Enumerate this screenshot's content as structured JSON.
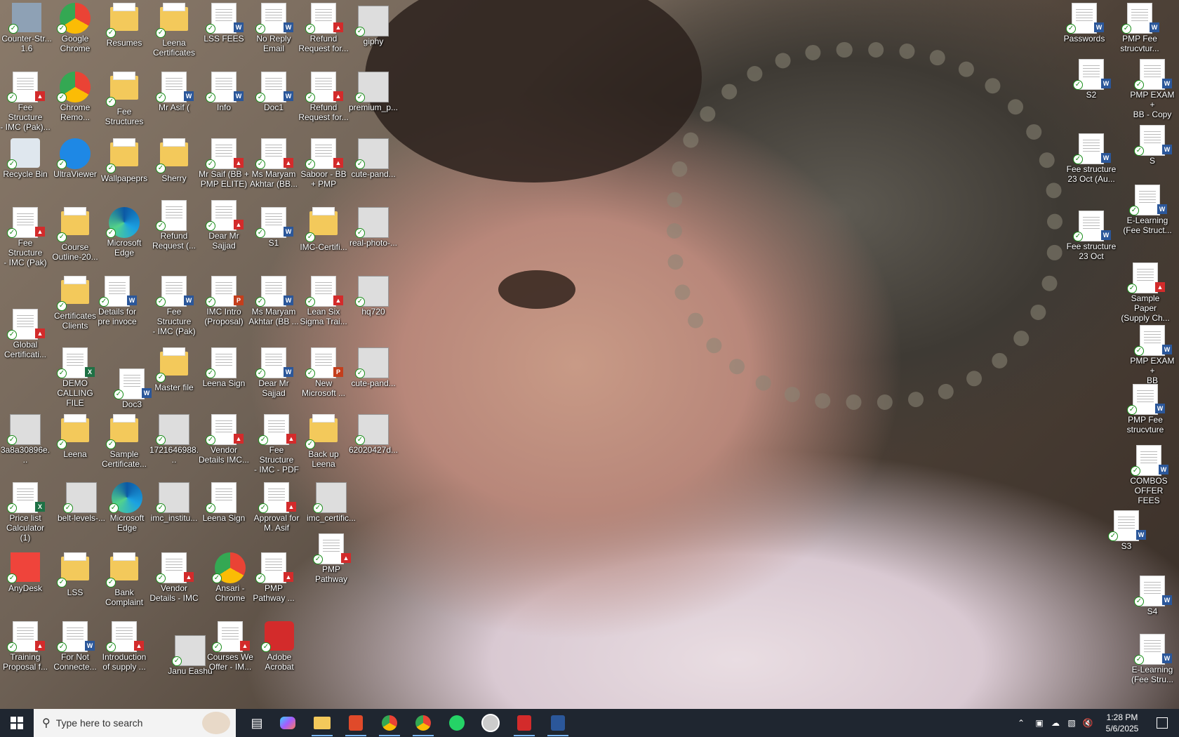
{
  "desktop": {
    "icons": [
      {
        "label": "Counter-Str...\n1.6",
        "kind": "game"
      },
      {
        "label": "Google\nChrome",
        "kind": "chrome"
      },
      {
        "label": "Resumes",
        "kind": "folder"
      },
      {
        "label": "Leena\nCertificates",
        "kind": "folder"
      },
      {
        "label": "LSS FEES",
        "kind": "word"
      },
      {
        "label": "No Reply\nEmail",
        "kind": "word"
      },
      {
        "label": "Refund\nRequest for...",
        "kind": "pdf"
      },
      {
        "label": "giphy",
        "kind": "photo"
      },
      {
        "label": "Fee Structure\n- IMC (Pak)...",
        "kind": "pdf"
      },
      {
        "label": "Chrome\nRemo...",
        "kind": "chrome"
      },
      {
        "label": "Fee\nStructures",
        "kind": "folder"
      },
      {
        "label": "Mr Asif (",
        "kind": "word"
      },
      {
        "label": "Info",
        "kind": "word"
      },
      {
        "label": "Doc1",
        "kind": "word"
      },
      {
        "label": "Refund\nRequest for...",
        "kind": "pdf"
      },
      {
        "label": "premium_p...",
        "kind": "photo"
      },
      {
        "label": "Recycle Bin",
        "kind": "bin"
      },
      {
        "label": "UltraViewer",
        "kind": "ultraviewer"
      },
      {
        "label": "Wallpapeprs",
        "kind": "folder"
      },
      {
        "label": "Sherry",
        "kind": "folder"
      },
      {
        "label": "Mr Saif (BB +\nPMP ELITE)",
        "kind": "pdf"
      },
      {
        "label": "Ms Maryam\nAkhtar (BB...",
        "kind": "pdf"
      },
      {
        "label": "Saboor - BB\n+ PMP",
        "kind": "pdf"
      },
      {
        "label": "cute-pand...",
        "kind": "photo"
      },
      {
        "label": "Fee Structure\n- IMC (Pak)",
        "kind": "pdf"
      },
      {
        "label": "Course\nOutline-20...",
        "kind": "folder"
      },
      {
        "label": "Microsoft\nEdge",
        "kind": "edge"
      },
      {
        "label": "Refund\nRequest (...",
        "kind": "doc"
      },
      {
        "label": "Dear Mr\nSajjad",
        "kind": "pdf"
      },
      {
        "label": "S1",
        "kind": "word"
      },
      {
        "label": "IMC-Certifi...",
        "kind": "folder"
      },
      {
        "label": "real-photo-...",
        "kind": "photo"
      },
      {
        "label": "Global\nCertificati...",
        "kind": "pdf"
      },
      {
        "label": "Certificates\nClients",
        "kind": "folder"
      },
      {
        "label": "Details for\npre invoce",
        "kind": "word"
      },
      {
        "label": "Fee Structure\n- IMC (Pak)",
        "kind": "word"
      },
      {
        "label": "IMC Intro\n(Proposal)",
        "kind": "ppt"
      },
      {
        "label": "Ms Maryam\nAkhtar (BB ...",
        "kind": "word"
      },
      {
        "label": "Lean Six\nSigma Trai...",
        "kind": "pdf"
      },
      {
        "label": "hq720",
        "kind": "photo"
      },
      {
        "label": "DEMO\nCALLING FILE",
        "kind": "excel"
      },
      {
        "label": "Doc3",
        "kind": "word"
      },
      {
        "label": "Master file",
        "kind": "folder"
      },
      {
        "label": "Leena Sign",
        "kind": "doc"
      },
      {
        "label": "Dear Mr\nSajjad",
        "kind": "word"
      },
      {
        "label": "New\nMicrosoft ...",
        "kind": "ppt"
      },
      {
        "label": "cute-pand...",
        "kind": "photo"
      },
      {
        "label": "3a8a30896e...",
        "kind": "photo"
      },
      {
        "label": "Leena",
        "kind": "folder"
      },
      {
        "label": "Sample\nCertificate...",
        "kind": "folder"
      },
      {
        "label": "1721646988...",
        "kind": "photo"
      },
      {
        "label": "Vendor\nDetails IMC...",
        "kind": "pdf"
      },
      {
        "label": "Fee Structure\n- IMC - PDF",
        "kind": "pdf"
      },
      {
        "label": "Back up\nLeena",
        "kind": "folder"
      },
      {
        "label": "62020427d...",
        "kind": "photo"
      },
      {
        "label": "Price list\nCalculator (1)",
        "kind": "excel"
      },
      {
        "label": "belt-levels-...",
        "kind": "photo"
      },
      {
        "label": "Microsoft\nEdge",
        "kind": "edge"
      },
      {
        "label": "imc_institu...",
        "kind": "photo"
      },
      {
        "label": "Leena Sign",
        "kind": "doc"
      },
      {
        "label": "Approval for\nM. Asif",
        "kind": "pdf"
      },
      {
        "label": "imc_certific...",
        "kind": "photo"
      },
      {
        "label": "PMP\nPathway",
        "kind": "pdf"
      },
      {
        "label": "AnyDesk",
        "kind": "anydesk"
      },
      {
        "label": "LSS",
        "kind": "folder"
      },
      {
        "label": "Bank\nComplaint",
        "kind": "folder"
      },
      {
        "label": "Vendor\nDetails - IMC",
        "kind": "pdf"
      },
      {
        "label": "Ansari -\nChrome",
        "kind": "chrome"
      },
      {
        "label": "PMP\nPathway ...",
        "kind": "pdf"
      },
      {
        "label": "Training\nProposal f...",
        "kind": "pdf"
      },
      {
        "label": "For Not\nConnecte...",
        "kind": "word"
      },
      {
        "label": "Introduction\nof supply ...",
        "kind": "pdf"
      },
      {
        "label": "Janu Eashu",
        "kind": "photo"
      },
      {
        "label": "Courses We\nOffer - IM...",
        "kind": "pdf"
      },
      {
        "label": "Adobe\nAcrobat",
        "kind": "acrobat"
      },
      {
        "label": "Passwords",
        "kind": "word"
      },
      {
        "label": "PMP Fee\nstrucvtur...",
        "kind": "word"
      },
      {
        "label": "S2",
        "kind": "word"
      },
      {
        "label": "PMP EXAM +\nBB - Copy",
        "kind": "word"
      },
      {
        "label": "S",
        "kind": "word"
      },
      {
        "label": "Fee structure\n23 Oct (Au...",
        "kind": "word"
      },
      {
        "label": "E-Learning\n(Fee Struct...",
        "kind": "word"
      },
      {
        "label": "Fee structure\n23 Oct",
        "kind": "word"
      },
      {
        "label": "Sample Paper\n(Supply Ch...",
        "kind": "pdf"
      },
      {
        "label": "PMP EXAM +\nBB",
        "kind": "word"
      },
      {
        "label": "PMP Fee\nstrucvture",
        "kind": "word"
      },
      {
        "label": "COMBOS\nOFFER FEES",
        "kind": "word"
      },
      {
        "label": "S3",
        "kind": "word"
      },
      {
        "label": "S4",
        "kind": "word"
      },
      {
        "label": "E-Learning\n(Fee Stru...",
        "kind": "word"
      }
    ]
  },
  "taskbar": {
    "search_placeholder": "Type here to search",
    "apps": [
      "task-view",
      "copilot",
      "file-explorer",
      "app-red",
      "chrome",
      "chrome-profile",
      "whatsapp",
      "clock-app",
      "acrobat",
      "word"
    ],
    "tray": {
      "time": "1:28 PM",
      "date": "5/6/2025"
    },
    "colors": {
      "taskbar_bg": "#1f2630",
      "accent": "#7cb8ff"
    }
  }
}
